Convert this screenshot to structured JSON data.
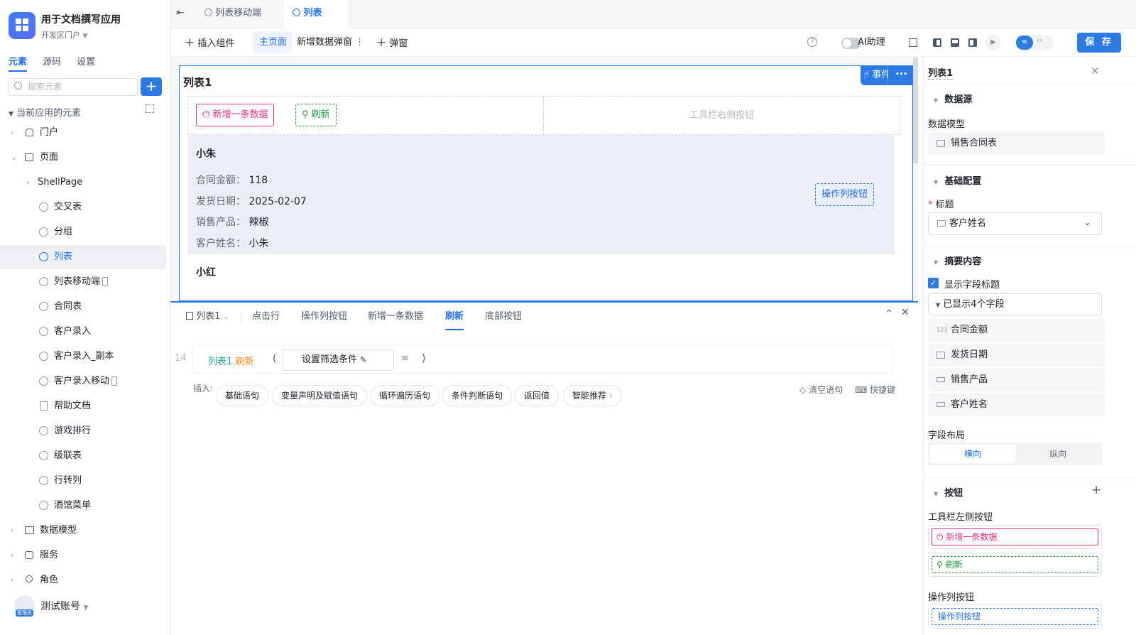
{
  "app": {
    "name": "用于文档撰写应用",
    "portal": "开发区门户"
  },
  "left_tabs": [
    "元素",
    "源码",
    "设置"
  ],
  "search": {
    "placeholder": "搜索元素"
  },
  "tree": {
    "header": "当前应用的元素",
    "items": [
      {
        "label": "门户"
      },
      {
        "label": "页面"
      },
      {
        "label": "ShellPage"
      },
      {
        "label": "交叉表"
      },
      {
        "label": "分组"
      },
      {
        "label": "列表"
      },
      {
        "label": "列表移动端"
      },
      {
        "label": "合同表"
      },
      {
        "label": "客户录入"
      },
      {
        "label": "客户录入_副本"
      },
      {
        "label": "客户录入移动"
      },
      {
        "label": "帮助文档"
      },
      {
        "label": "游戏排行"
      },
      {
        "label": "级联表"
      },
      {
        "label": "行转列"
      },
      {
        "label": "酒馆菜单"
      },
      {
        "label": "数据模型"
      },
      {
        "label": "服务"
      },
      {
        "label": "角色"
      }
    ]
  },
  "account": {
    "name": "测试账号",
    "role": "管理员"
  },
  "file_tabs": [
    "列表移动端",
    "列表"
  ],
  "toolbar": {
    "insert": "插入组件",
    "main_page": "主页面",
    "new_dialog": "新增数据弹窗",
    "popup": "弹窗",
    "ai": "AI助理",
    "save": "保 存"
  },
  "canvas": {
    "title": "列表1",
    "event_btn": "事件",
    "add_btn": "新增一条数据",
    "refresh_btn": "刷新",
    "right_placeholder": "工具栏右侧按钮",
    "record1": {
      "name": "小朱",
      "fields": [
        {
          "label": "合同金额：",
          "value": "118"
        },
        {
          "label": "发货日期：",
          "value": "2025-02-07"
        },
        {
          "label": "销售产品：",
          "value": "辣椒"
        },
        {
          "label": "客户姓名：",
          "value": "小朱"
        }
      ],
      "action_btn": "操作列按钮"
    },
    "record2": {
      "name": "小红"
    }
  },
  "bottom": {
    "selector": "列表1",
    "tabs": [
      "点击行",
      "操作列按钮",
      "新增一条数据",
      "刷新",
      "底部按钮"
    ],
    "line_no": "14",
    "code_obj": "列表1",
    "code_dot": ".",
    "code_method": "刷新",
    "code_open": "(",
    "code_close": ")",
    "filter_btn": "设置筛选条件",
    "insert_label": "插入:",
    "chips": [
      "基础语句",
      "变量声明及赋值语句",
      "循环遍历语句",
      "条件判断语句",
      "返回值",
      "智能推荐"
    ],
    "clear": "清空语句",
    "shortcut": "快捷键"
  },
  "right": {
    "title": "列表1",
    "datasource_sec": "数据源",
    "data_model_label": "数据模型",
    "data_model_value": "销售合同表",
    "basic_sec": "基础配置",
    "title_label": "标题",
    "title_value": "客户姓名",
    "summary_sec": "摘要内容",
    "show_field_title": "显示字段标题",
    "shown_fields": "已显示4个字段",
    "fields": [
      {
        "label": "合同金额"
      },
      {
        "label": "发货日期"
      },
      {
        "label": "销售产品"
      },
      {
        "label": "客户姓名"
      }
    ],
    "layout_label": "字段布局",
    "layout_h": "横向",
    "layout_v": "纵向",
    "buttons_sec": "按钮",
    "toolbar_left_label": "工具栏左侧按钮",
    "btn_add": "新增一条数据",
    "btn_refresh": "刷新",
    "action_col_label": "操作列按钮",
    "btn_action": "操作列按钮"
  },
  "colors": {
    "accent": "#2c7be5",
    "danger": "#e8317a",
    "success": "#1f9d3a"
  }
}
